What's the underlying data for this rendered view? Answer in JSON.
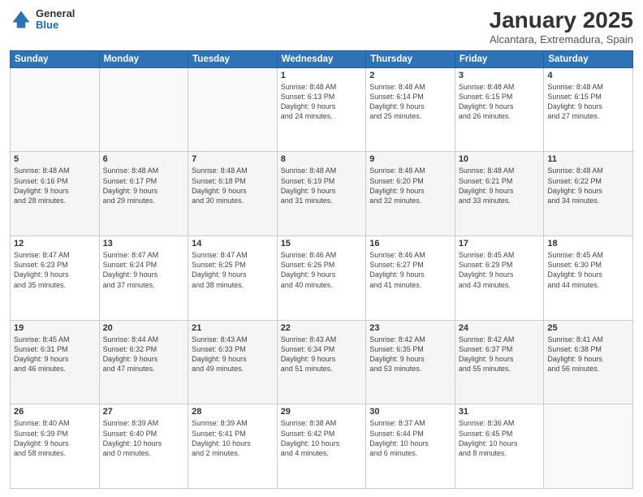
{
  "logo": {
    "general": "General",
    "blue": "Blue"
  },
  "header": {
    "month_title": "January 2025",
    "location": "Alcantara, Extremadura, Spain"
  },
  "weekdays": [
    "Sunday",
    "Monday",
    "Tuesday",
    "Wednesday",
    "Thursday",
    "Friday",
    "Saturday"
  ],
  "weeks": [
    [
      {
        "day": "",
        "info": ""
      },
      {
        "day": "",
        "info": ""
      },
      {
        "day": "",
        "info": ""
      },
      {
        "day": "1",
        "info": "Sunrise: 8:48 AM\nSunset: 6:13 PM\nDaylight: 9 hours\nand 24 minutes."
      },
      {
        "day": "2",
        "info": "Sunrise: 8:48 AM\nSunset: 6:14 PM\nDaylight: 9 hours\nand 25 minutes."
      },
      {
        "day": "3",
        "info": "Sunrise: 8:48 AM\nSunset: 6:15 PM\nDaylight: 9 hours\nand 26 minutes."
      },
      {
        "day": "4",
        "info": "Sunrise: 8:48 AM\nSunset: 6:15 PM\nDaylight: 9 hours\nand 27 minutes."
      }
    ],
    [
      {
        "day": "5",
        "info": "Sunrise: 8:48 AM\nSunset: 6:16 PM\nDaylight: 9 hours\nand 28 minutes."
      },
      {
        "day": "6",
        "info": "Sunrise: 8:48 AM\nSunset: 6:17 PM\nDaylight: 9 hours\nand 29 minutes."
      },
      {
        "day": "7",
        "info": "Sunrise: 8:48 AM\nSunset: 6:18 PM\nDaylight: 9 hours\nand 30 minutes."
      },
      {
        "day": "8",
        "info": "Sunrise: 8:48 AM\nSunset: 6:19 PM\nDaylight: 9 hours\nand 31 minutes."
      },
      {
        "day": "9",
        "info": "Sunrise: 8:48 AM\nSunset: 6:20 PM\nDaylight: 9 hours\nand 32 minutes."
      },
      {
        "day": "10",
        "info": "Sunrise: 8:48 AM\nSunset: 6:21 PM\nDaylight: 9 hours\nand 33 minutes."
      },
      {
        "day": "11",
        "info": "Sunrise: 8:48 AM\nSunset: 6:22 PM\nDaylight: 9 hours\nand 34 minutes."
      }
    ],
    [
      {
        "day": "12",
        "info": "Sunrise: 8:47 AM\nSunset: 6:23 PM\nDaylight: 9 hours\nand 35 minutes."
      },
      {
        "day": "13",
        "info": "Sunrise: 8:47 AM\nSunset: 6:24 PM\nDaylight: 9 hours\nand 37 minutes."
      },
      {
        "day": "14",
        "info": "Sunrise: 8:47 AM\nSunset: 6:25 PM\nDaylight: 9 hours\nand 38 minutes."
      },
      {
        "day": "15",
        "info": "Sunrise: 8:46 AM\nSunset: 6:26 PM\nDaylight: 9 hours\nand 40 minutes."
      },
      {
        "day": "16",
        "info": "Sunrise: 8:46 AM\nSunset: 6:27 PM\nDaylight: 9 hours\nand 41 minutes."
      },
      {
        "day": "17",
        "info": "Sunrise: 8:45 AM\nSunset: 6:29 PM\nDaylight: 9 hours\nand 43 minutes."
      },
      {
        "day": "18",
        "info": "Sunrise: 8:45 AM\nSunset: 6:30 PM\nDaylight: 9 hours\nand 44 minutes."
      }
    ],
    [
      {
        "day": "19",
        "info": "Sunrise: 8:45 AM\nSunset: 6:31 PM\nDaylight: 9 hours\nand 46 minutes."
      },
      {
        "day": "20",
        "info": "Sunrise: 8:44 AM\nSunset: 6:32 PM\nDaylight: 9 hours\nand 47 minutes."
      },
      {
        "day": "21",
        "info": "Sunrise: 8:43 AM\nSunset: 6:33 PM\nDaylight: 9 hours\nand 49 minutes."
      },
      {
        "day": "22",
        "info": "Sunrise: 8:43 AM\nSunset: 6:34 PM\nDaylight: 9 hours\nand 51 minutes."
      },
      {
        "day": "23",
        "info": "Sunrise: 8:42 AM\nSunset: 6:35 PM\nDaylight: 9 hours\nand 53 minutes."
      },
      {
        "day": "24",
        "info": "Sunrise: 8:42 AM\nSunset: 6:37 PM\nDaylight: 9 hours\nand 55 minutes."
      },
      {
        "day": "25",
        "info": "Sunrise: 8:41 AM\nSunset: 6:38 PM\nDaylight: 9 hours\nand 56 minutes."
      }
    ],
    [
      {
        "day": "26",
        "info": "Sunrise: 8:40 AM\nSunset: 6:39 PM\nDaylight: 9 hours\nand 58 minutes."
      },
      {
        "day": "27",
        "info": "Sunrise: 8:39 AM\nSunset: 6:40 PM\nDaylight: 10 hours\nand 0 minutes."
      },
      {
        "day": "28",
        "info": "Sunrise: 8:39 AM\nSunset: 6:41 PM\nDaylight: 10 hours\nand 2 minutes."
      },
      {
        "day": "29",
        "info": "Sunrise: 8:38 AM\nSunset: 6:42 PM\nDaylight: 10 hours\nand 4 minutes."
      },
      {
        "day": "30",
        "info": "Sunrise: 8:37 AM\nSunset: 6:44 PM\nDaylight: 10 hours\nand 6 minutes."
      },
      {
        "day": "31",
        "info": "Sunrise: 8:36 AM\nSunset: 6:45 PM\nDaylight: 10 hours\nand 8 minutes."
      },
      {
        "day": "",
        "info": ""
      }
    ]
  ]
}
